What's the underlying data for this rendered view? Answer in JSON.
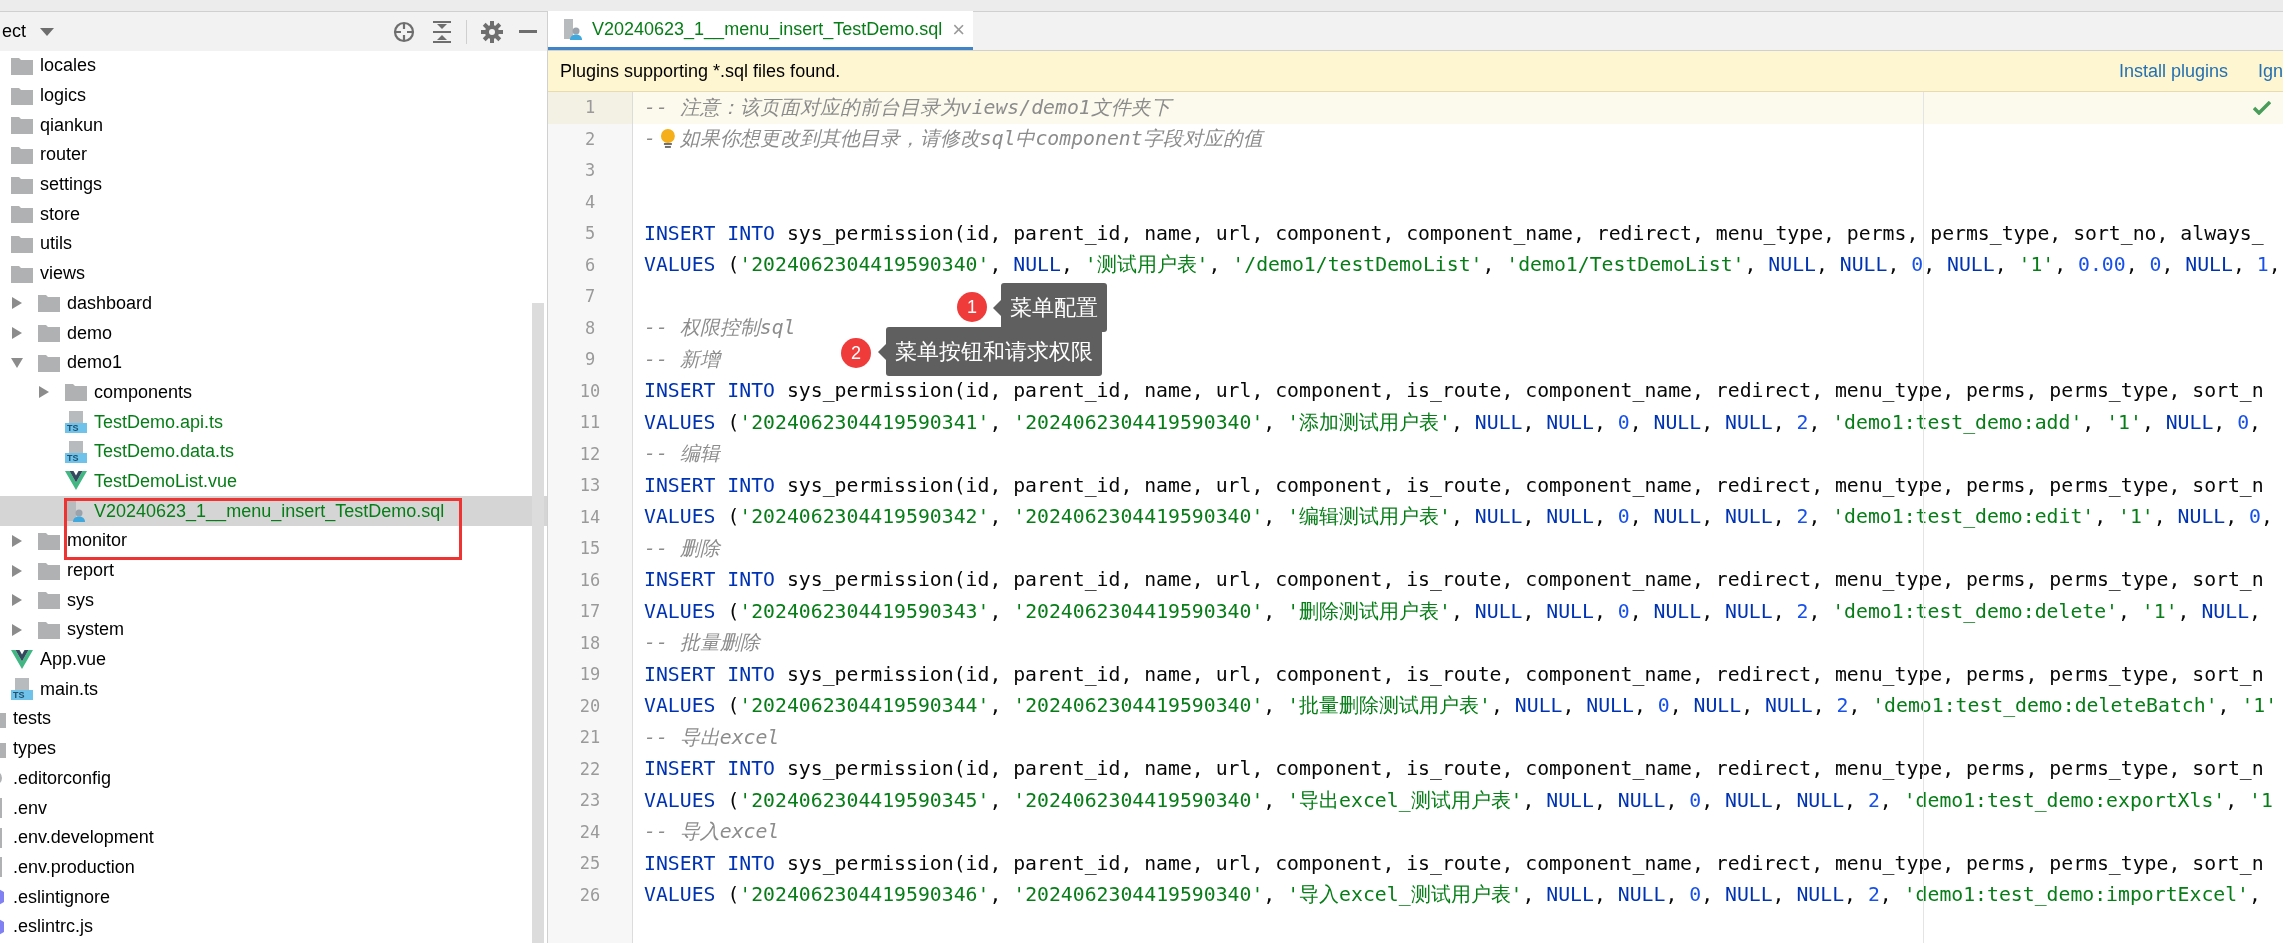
{
  "project_panel": {
    "title": "ect"
  },
  "tree": {
    "inner_items": [
      {
        "name": "locales",
        "kind": "folder",
        "selected": false
      },
      {
        "name": "logics",
        "kind": "folder",
        "selected": false
      },
      {
        "name": "qiankun",
        "kind": "folder",
        "selected": false
      },
      {
        "name": "router",
        "kind": "folder",
        "selected": false
      },
      {
        "name": "settings",
        "kind": "folder",
        "selected": false
      },
      {
        "name": "store",
        "kind": "folder",
        "selected": false
      },
      {
        "name": "utils",
        "kind": "folder",
        "selected": false
      },
      {
        "name": "views",
        "kind": "folder",
        "selected": false,
        "children": [
          {
            "name": "dashboard",
            "kind": "folder",
            "expanded": false,
            "selected": false
          },
          {
            "name": "demo",
            "kind": "folder",
            "expanded": false,
            "selected": false
          },
          {
            "name": "demo1",
            "kind": "folder",
            "expanded": true,
            "selected": false,
            "children": [
              {
                "name": "components",
                "kind": "folder",
                "expanded": false,
                "selected": false
              },
              {
                "name": "TestDemo.api.ts",
                "kind": "ts",
                "icon_text": "TS",
                "color": "#067d17",
                "selected": false
              },
              {
                "name": "TestDemo.data.ts",
                "kind": "ts",
                "icon_text": "TS",
                "color": "#067d17",
                "selected": false
              },
              {
                "name": "TestDemoList.vue",
                "kind": "vue",
                "color": "#067d17",
                "selected": false
              },
              {
                "name": "V20240623_1__menu_insert_TestDemo.sql",
                "kind": "sql",
                "color": "#067d17",
                "selected": true
              }
            ]
          },
          {
            "name": "monitor",
            "kind": "folder",
            "expanded": false,
            "selected": false
          },
          {
            "name": "report",
            "kind": "folder",
            "expanded": false,
            "selected": false
          },
          {
            "name": "sys",
            "kind": "folder",
            "expanded": false,
            "selected": false
          },
          {
            "name": "system",
            "kind": "folder",
            "expanded": false,
            "selected": false
          }
        ]
      },
      {
        "name": "App.vue",
        "kind": "vue",
        "selected": false
      },
      {
        "name": "main.ts",
        "kind": "ts",
        "icon_text": "TS",
        "selected": false
      }
    ],
    "outer_items": [
      {
        "name": "tests",
        "kind": "folder",
        "selected": false
      },
      {
        "name": "types",
        "kind": "folder",
        "selected": false
      },
      {
        "name": ".editorconfig",
        "kind": "config",
        "selected": false
      },
      {
        "name": ".env",
        "kind": "plain",
        "selected": false
      },
      {
        "name": ".env.development",
        "kind": "plain",
        "selected": false
      },
      {
        "name": ".env.production",
        "kind": "plain",
        "selected": false
      },
      {
        "name": ".eslintignore",
        "kind": "eslint",
        "selected": false
      },
      {
        "name": ".eslintrc.js",
        "kind": "eslint",
        "selected": false
      }
    ]
  },
  "editor_tab": {
    "title": "V20240623_1__menu_insert_TestDemo.sql",
    "close": "×",
    "selected": true
  },
  "notification": {
    "message": "Plugins supporting *.sql files found.",
    "links": [
      "Install plugins",
      "Ign"
    ]
  },
  "code_lines": [
    {
      "number": "1",
      "current": true,
      "tokens": [
        {
          "kind": "comment",
          "text": "-- 注意：该页面对应的前台目录为views/demo1文件夹下"
        }
      ]
    },
    {
      "number": "2",
      "current": false,
      "tokens": [
        {
          "kind": "comment",
          "text": "-"
        },
        {
          "kind": "bulb"
        },
        {
          "kind": "comment",
          "text": "如果你想更改到其他目录，请修改sql中component字段对应的值"
        }
      ]
    },
    {
      "number": "3",
      "current": false
    },
    {
      "number": "4",
      "current": false
    },
    {
      "number": "5",
      "current": false,
      "tokens": [
        {
          "kind": "keyword",
          "text": "INSERT INTO"
        },
        {
          "kind": "text",
          "text": " sys_permission(id, parent_id, name, url, component, component_name, redirect, menu_type, perms, perms_type, sort_no, always_"
        }
      ]
    },
    {
      "number": "6",
      "current": false,
      "tokens": [
        {
          "kind": "keyword",
          "text": "VALUES"
        },
        {
          "kind": "text",
          "text": " ("
        },
        {
          "kind": "string",
          "text": "'2024062304419590340'"
        },
        {
          "kind": "text",
          "text": ", "
        },
        {
          "kind": "keyword",
          "text": "NULL"
        },
        {
          "kind": "text",
          "text": ", "
        },
        {
          "kind": "string",
          "text": "'测试用户表'"
        },
        {
          "kind": "text",
          "text": ", "
        },
        {
          "kind": "string",
          "text": "'/demo1/testDemoList'"
        },
        {
          "kind": "text",
          "text": ", "
        },
        {
          "kind": "string",
          "text": "'demo1/TestDemoList'"
        },
        {
          "kind": "text",
          "text": ", "
        },
        {
          "kind": "keyword",
          "text": "NULL"
        },
        {
          "kind": "text",
          "text": ", "
        },
        {
          "kind": "keyword",
          "text": "NULL"
        },
        {
          "kind": "text",
          "text": ", "
        },
        {
          "kind": "number",
          "text": "0"
        },
        {
          "kind": "text",
          "text": ", "
        },
        {
          "kind": "keyword",
          "text": "NULL"
        },
        {
          "kind": "text",
          "text": ", "
        },
        {
          "kind": "string",
          "text": "'1'"
        },
        {
          "kind": "text",
          "text": ", "
        },
        {
          "kind": "number",
          "text": "0.00"
        },
        {
          "kind": "text",
          "text": ", "
        },
        {
          "kind": "number",
          "text": "0"
        },
        {
          "kind": "text",
          "text": ", "
        },
        {
          "kind": "keyword",
          "text": "NULL"
        },
        {
          "kind": "text",
          "text": ", "
        },
        {
          "kind": "number",
          "text": "1"
        },
        {
          "kind": "text",
          "text": ","
        }
      ]
    },
    {
      "number": "7",
      "current": false
    },
    {
      "number": "8",
      "current": false,
      "tokens": [
        {
          "kind": "comment",
          "text": "-- 权限控制sql"
        }
      ]
    },
    {
      "number": "9",
      "current": false,
      "tokens": [
        {
          "kind": "comment",
          "text": "-- 新增"
        }
      ]
    },
    {
      "number": "10",
      "current": false,
      "tokens": [
        {
          "kind": "keyword",
          "text": "INSERT INTO"
        },
        {
          "kind": "text",
          "text": " sys_permission(id, parent_id, name, url, component, is_route, component_name, redirect, menu_type, perms, perms_type, sort_n"
        }
      ]
    },
    {
      "number": "11",
      "current": false,
      "tokens": [
        {
          "kind": "keyword",
          "text": "VALUES"
        },
        {
          "kind": "text",
          "text": " ("
        },
        {
          "kind": "string",
          "text": "'2024062304419590341'"
        },
        {
          "kind": "text",
          "text": ", "
        },
        {
          "kind": "string",
          "text": "'2024062304419590340'"
        },
        {
          "kind": "text",
          "text": ", "
        },
        {
          "kind": "string",
          "text": "'添加测试用户表'"
        },
        {
          "kind": "text",
          "text": ", "
        },
        {
          "kind": "keyword",
          "text": "NULL"
        },
        {
          "kind": "text",
          "text": ", "
        },
        {
          "kind": "keyword",
          "text": "NULL"
        },
        {
          "kind": "text",
          "text": ", "
        },
        {
          "kind": "number",
          "text": "0"
        },
        {
          "kind": "text",
          "text": ", "
        },
        {
          "kind": "keyword",
          "text": "NULL"
        },
        {
          "kind": "text",
          "text": ", "
        },
        {
          "kind": "keyword",
          "text": "NULL"
        },
        {
          "kind": "text",
          "text": ", "
        },
        {
          "kind": "number",
          "text": "2"
        },
        {
          "kind": "text",
          "text": ", "
        },
        {
          "kind": "string",
          "text": "'demo1:test_demo:add'"
        },
        {
          "kind": "text",
          "text": ", "
        },
        {
          "kind": "string",
          "text": "'1'"
        },
        {
          "kind": "text",
          "text": ", "
        },
        {
          "kind": "keyword",
          "text": "NULL"
        },
        {
          "kind": "text",
          "text": ", "
        },
        {
          "kind": "number",
          "text": "0"
        },
        {
          "kind": "text",
          "text": ","
        }
      ]
    },
    {
      "number": "12",
      "current": false,
      "tokens": [
        {
          "kind": "comment",
          "text": "-- 编辑"
        }
      ]
    },
    {
      "number": "13",
      "current": false,
      "tokens": [
        {
          "kind": "keyword",
          "text": "INSERT INTO"
        },
        {
          "kind": "text",
          "text": " sys_permission(id, parent_id, name, url, component, is_route, component_name, redirect, menu_type, perms, perms_type, sort_n"
        }
      ]
    },
    {
      "number": "14",
      "current": false,
      "tokens": [
        {
          "kind": "keyword",
          "text": "VALUES"
        },
        {
          "kind": "text",
          "text": " ("
        },
        {
          "kind": "string",
          "text": "'2024062304419590342'"
        },
        {
          "kind": "text",
          "text": ", "
        },
        {
          "kind": "string",
          "text": "'2024062304419590340'"
        },
        {
          "kind": "text",
          "text": ", "
        },
        {
          "kind": "string",
          "text": "'编辑测试用户表'"
        },
        {
          "kind": "text",
          "text": ", "
        },
        {
          "kind": "keyword",
          "text": "NULL"
        },
        {
          "kind": "text",
          "text": ", "
        },
        {
          "kind": "keyword",
          "text": "NULL"
        },
        {
          "kind": "text",
          "text": ", "
        },
        {
          "kind": "number",
          "text": "0"
        },
        {
          "kind": "text",
          "text": ", "
        },
        {
          "kind": "keyword",
          "text": "NULL"
        },
        {
          "kind": "text",
          "text": ", "
        },
        {
          "kind": "keyword",
          "text": "NULL"
        },
        {
          "kind": "text",
          "text": ", "
        },
        {
          "kind": "number",
          "text": "2"
        },
        {
          "kind": "text",
          "text": ", "
        },
        {
          "kind": "string",
          "text": "'demo1:test_demo:edit'"
        },
        {
          "kind": "text",
          "text": ", "
        },
        {
          "kind": "string",
          "text": "'1'"
        },
        {
          "kind": "text",
          "text": ", "
        },
        {
          "kind": "keyword",
          "text": "NULL"
        },
        {
          "kind": "text",
          "text": ", "
        },
        {
          "kind": "number",
          "text": "0"
        },
        {
          "kind": "text",
          "text": ","
        }
      ]
    },
    {
      "number": "15",
      "current": false,
      "tokens": [
        {
          "kind": "comment",
          "text": "-- 删除"
        }
      ]
    },
    {
      "number": "16",
      "current": false,
      "tokens": [
        {
          "kind": "keyword",
          "text": "INSERT INTO"
        },
        {
          "kind": "text",
          "text": " sys_permission(id, parent_id, name, url, component, is_route, component_name, redirect, menu_type, perms, perms_type, sort_n"
        }
      ]
    },
    {
      "number": "17",
      "current": false,
      "tokens": [
        {
          "kind": "keyword",
          "text": "VALUES"
        },
        {
          "kind": "text",
          "text": " ("
        },
        {
          "kind": "string",
          "text": "'2024062304419590343'"
        },
        {
          "kind": "text",
          "text": ", "
        },
        {
          "kind": "string",
          "text": "'2024062304419590340'"
        },
        {
          "kind": "text",
          "text": ", "
        },
        {
          "kind": "string",
          "text": "'删除测试用户表'"
        },
        {
          "kind": "text",
          "text": ", "
        },
        {
          "kind": "keyword",
          "text": "NULL"
        },
        {
          "kind": "text",
          "text": ", "
        },
        {
          "kind": "keyword",
          "text": "NULL"
        },
        {
          "kind": "text",
          "text": ", "
        },
        {
          "kind": "number",
          "text": "0"
        },
        {
          "kind": "text",
          "text": ", "
        },
        {
          "kind": "keyword",
          "text": "NULL"
        },
        {
          "kind": "text",
          "text": ", "
        },
        {
          "kind": "keyword",
          "text": "NULL"
        },
        {
          "kind": "text",
          "text": ", "
        },
        {
          "kind": "number",
          "text": "2"
        },
        {
          "kind": "text",
          "text": ", "
        },
        {
          "kind": "string",
          "text": "'demo1:test_demo:delete'"
        },
        {
          "kind": "text",
          "text": ", "
        },
        {
          "kind": "string",
          "text": "'1'"
        },
        {
          "kind": "text",
          "text": ", "
        },
        {
          "kind": "keyword",
          "text": "NULL"
        },
        {
          "kind": "text",
          "text": ","
        }
      ]
    },
    {
      "number": "18",
      "current": false,
      "tokens": [
        {
          "kind": "comment",
          "text": "-- 批量删除"
        }
      ]
    },
    {
      "number": "19",
      "current": false,
      "tokens": [
        {
          "kind": "keyword",
          "text": "INSERT INTO"
        },
        {
          "kind": "text",
          "text": " sys_permission(id, parent_id, name, url, component, is_route, component_name, redirect, menu_type, perms, perms_type, sort_n"
        }
      ]
    },
    {
      "number": "20",
      "current": false,
      "tokens": [
        {
          "kind": "keyword",
          "text": "VALUES"
        },
        {
          "kind": "text",
          "text": " ("
        },
        {
          "kind": "string",
          "text": "'2024062304419590344'"
        },
        {
          "kind": "text",
          "text": ", "
        },
        {
          "kind": "string",
          "text": "'2024062304419590340'"
        },
        {
          "kind": "text",
          "text": ", "
        },
        {
          "kind": "string",
          "text": "'批量删除测试用户表'"
        },
        {
          "kind": "text",
          "text": ", "
        },
        {
          "kind": "keyword",
          "text": "NULL"
        },
        {
          "kind": "text",
          "text": ", "
        },
        {
          "kind": "keyword",
          "text": "NULL"
        },
        {
          "kind": "text",
          "text": ", "
        },
        {
          "kind": "number",
          "text": "0"
        },
        {
          "kind": "text",
          "text": ", "
        },
        {
          "kind": "keyword",
          "text": "NULL"
        },
        {
          "kind": "text",
          "text": ", "
        },
        {
          "kind": "keyword",
          "text": "NULL"
        },
        {
          "kind": "text",
          "text": ", "
        },
        {
          "kind": "number",
          "text": "2"
        },
        {
          "kind": "text",
          "text": ", "
        },
        {
          "kind": "string",
          "text": "'demo1:test_demo:deleteBatch'"
        },
        {
          "kind": "text",
          "text": ", "
        },
        {
          "kind": "string",
          "text": "'1'"
        }
      ]
    },
    {
      "number": "21",
      "current": false,
      "tokens": [
        {
          "kind": "comment",
          "text": "-- 导出excel"
        }
      ]
    },
    {
      "number": "22",
      "current": false,
      "tokens": [
        {
          "kind": "keyword",
          "text": "INSERT INTO"
        },
        {
          "kind": "text",
          "text": " sys_permission(id, parent_id, name, url, component, is_route, component_name, redirect, menu_type, perms, perms_type, sort_n"
        }
      ]
    },
    {
      "number": "23",
      "current": false,
      "tokens": [
        {
          "kind": "keyword",
          "text": "VALUES"
        },
        {
          "kind": "text",
          "text": " ("
        },
        {
          "kind": "string",
          "text": "'2024062304419590345'"
        },
        {
          "kind": "text",
          "text": ", "
        },
        {
          "kind": "string",
          "text": "'2024062304419590340'"
        },
        {
          "kind": "text",
          "text": ", "
        },
        {
          "kind": "string",
          "text": "'导出excel_测试用户表'"
        },
        {
          "kind": "text",
          "text": ", "
        },
        {
          "kind": "keyword",
          "text": "NULL"
        },
        {
          "kind": "text",
          "text": ", "
        },
        {
          "kind": "keyword",
          "text": "NULL"
        },
        {
          "kind": "text",
          "text": ", "
        },
        {
          "kind": "number",
          "text": "0"
        },
        {
          "kind": "text",
          "text": ", "
        },
        {
          "kind": "keyword",
          "text": "NULL"
        },
        {
          "kind": "text",
          "text": ", "
        },
        {
          "kind": "keyword",
          "text": "NULL"
        },
        {
          "kind": "text",
          "text": ", "
        },
        {
          "kind": "number",
          "text": "2"
        },
        {
          "kind": "text",
          "text": ", "
        },
        {
          "kind": "string",
          "text": "'demo1:test_demo:exportXls'"
        },
        {
          "kind": "text",
          "text": ", "
        },
        {
          "kind": "string",
          "text": "'1"
        }
      ]
    },
    {
      "number": "24",
      "current": false,
      "tokens": [
        {
          "kind": "comment",
          "text": "-- 导入excel"
        }
      ]
    },
    {
      "number": "25",
      "current": false,
      "tokens": [
        {
          "kind": "keyword",
          "text": "INSERT INTO"
        },
        {
          "kind": "text",
          "text": " sys_permission(id, parent_id, name, url, component, is_route, component_name, redirect, menu_type, perms, perms_type, sort_n"
        }
      ]
    },
    {
      "number": "26",
      "current": false,
      "tokens": [
        {
          "kind": "keyword",
          "text": "VALUES"
        },
        {
          "kind": "text",
          "text": " ("
        },
        {
          "kind": "string",
          "text": "'2024062304419590346'"
        },
        {
          "kind": "text",
          "text": ", "
        },
        {
          "kind": "string",
          "text": "'2024062304419590340'"
        },
        {
          "kind": "text",
          "text": ", "
        },
        {
          "kind": "string",
          "text": "'导入excel_测试用户表'"
        },
        {
          "kind": "text",
          "text": ", "
        },
        {
          "kind": "keyword",
          "text": "NULL"
        },
        {
          "kind": "text",
          "text": ", "
        },
        {
          "kind": "keyword",
          "text": "NULL"
        },
        {
          "kind": "text",
          "text": ", "
        },
        {
          "kind": "number",
          "text": "0"
        },
        {
          "kind": "text",
          "text": ", "
        },
        {
          "kind": "keyword",
          "text": "NULL"
        },
        {
          "kind": "text",
          "text": ", "
        },
        {
          "kind": "keyword",
          "text": "NULL"
        },
        {
          "kind": "text",
          "text": ", "
        },
        {
          "kind": "number",
          "text": "2"
        },
        {
          "kind": "text",
          "text": ", "
        },
        {
          "kind": "string",
          "text": "'demo1:test_demo:importExcel'"
        },
        {
          "kind": "text",
          "text": ","
        }
      ]
    }
  ],
  "annotations": [
    {
      "number": "1",
      "label": "菜单配置"
    },
    {
      "number": "2",
      "label": "菜单按钮和请求权限"
    }
  ]
}
